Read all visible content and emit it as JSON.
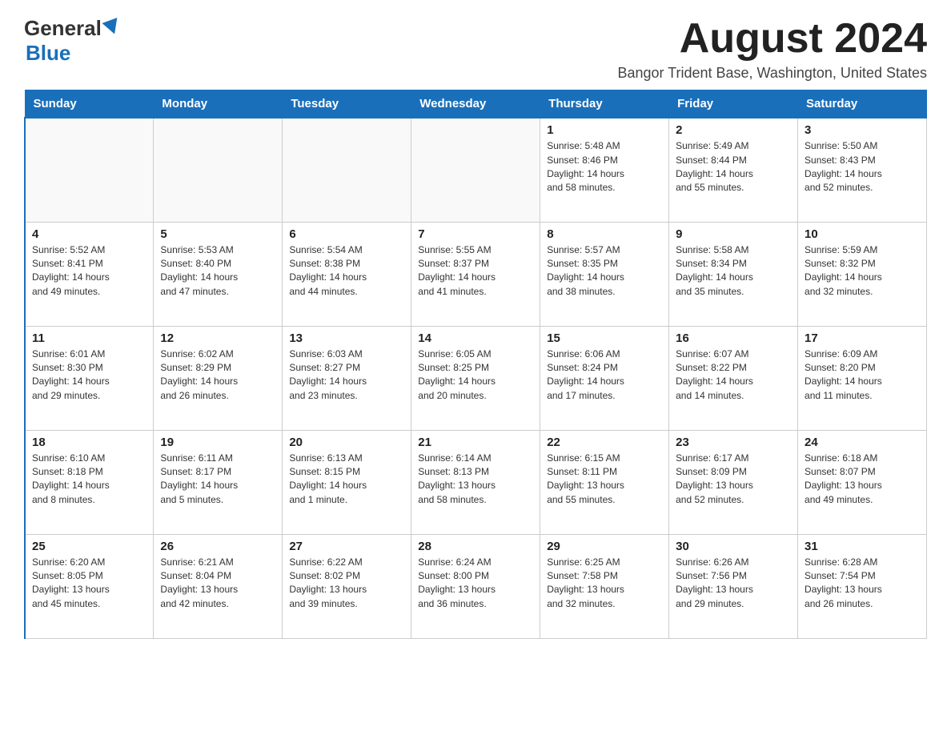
{
  "header": {
    "logo": {
      "general": "General",
      "blue": "Blue"
    },
    "title": "August 2024",
    "location": "Bangor Trident Base, Washington, United States"
  },
  "weekdays": [
    "Sunday",
    "Monday",
    "Tuesday",
    "Wednesday",
    "Thursday",
    "Friday",
    "Saturday"
  ],
  "weeks": [
    [
      {
        "day": "",
        "info": ""
      },
      {
        "day": "",
        "info": ""
      },
      {
        "day": "",
        "info": ""
      },
      {
        "day": "",
        "info": ""
      },
      {
        "day": "1",
        "info": "Sunrise: 5:48 AM\nSunset: 8:46 PM\nDaylight: 14 hours\nand 58 minutes."
      },
      {
        "day": "2",
        "info": "Sunrise: 5:49 AM\nSunset: 8:44 PM\nDaylight: 14 hours\nand 55 minutes."
      },
      {
        "day": "3",
        "info": "Sunrise: 5:50 AM\nSunset: 8:43 PM\nDaylight: 14 hours\nand 52 minutes."
      }
    ],
    [
      {
        "day": "4",
        "info": "Sunrise: 5:52 AM\nSunset: 8:41 PM\nDaylight: 14 hours\nand 49 minutes."
      },
      {
        "day": "5",
        "info": "Sunrise: 5:53 AM\nSunset: 8:40 PM\nDaylight: 14 hours\nand 47 minutes."
      },
      {
        "day": "6",
        "info": "Sunrise: 5:54 AM\nSunset: 8:38 PM\nDaylight: 14 hours\nand 44 minutes."
      },
      {
        "day": "7",
        "info": "Sunrise: 5:55 AM\nSunset: 8:37 PM\nDaylight: 14 hours\nand 41 minutes."
      },
      {
        "day": "8",
        "info": "Sunrise: 5:57 AM\nSunset: 8:35 PM\nDaylight: 14 hours\nand 38 minutes."
      },
      {
        "day": "9",
        "info": "Sunrise: 5:58 AM\nSunset: 8:34 PM\nDaylight: 14 hours\nand 35 minutes."
      },
      {
        "day": "10",
        "info": "Sunrise: 5:59 AM\nSunset: 8:32 PM\nDaylight: 14 hours\nand 32 minutes."
      }
    ],
    [
      {
        "day": "11",
        "info": "Sunrise: 6:01 AM\nSunset: 8:30 PM\nDaylight: 14 hours\nand 29 minutes."
      },
      {
        "day": "12",
        "info": "Sunrise: 6:02 AM\nSunset: 8:29 PM\nDaylight: 14 hours\nand 26 minutes."
      },
      {
        "day": "13",
        "info": "Sunrise: 6:03 AM\nSunset: 8:27 PM\nDaylight: 14 hours\nand 23 minutes."
      },
      {
        "day": "14",
        "info": "Sunrise: 6:05 AM\nSunset: 8:25 PM\nDaylight: 14 hours\nand 20 minutes."
      },
      {
        "day": "15",
        "info": "Sunrise: 6:06 AM\nSunset: 8:24 PM\nDaylight: 14 hours\nand 17 minutes."
      },
      {
        "day": "16",
        "info": "Sunrise: 6:07 AM\nSunset: 8:22 PM\nDaylight: 14 hours\nand 14 minutes."
      },
      {
        "day": "17",
        "info": "Sunrise: 6:09 AM\nSunset: 8:20 PM\nDaylight: 14 hours\nand 11 minutes."
      }
    ],
    [
      {
        "day": "18",
        "info": "Sunrise: 6:10 AM\nSunset: 8:18 PM\nDaylight: 14 hours\nand 8 minutes."
      },
      {
        "day": "19",
        "info": "Sunrise: 6:11 AM\nSunset: 8:17 PM\nDaylight: 14 hours\nand 5 minutes."
      },
      {
        "day": "20",
        "info": "Sunrise: 6:13 AM\nSunset: 8:15 PM\nDaylight: 14 hours\nand 1 minute."
      },
      {
        "day": "21",
        "info": "Sunrise: 6:14 AM\nSunset: 8:13 PM\nDaylight: 13 hours\nand 58 minutes."
      },
      {
        "day": "22",
        "info": "Sunrise: 6:15 AM\nSunset: 8:11 PM\nDaylight: 13 hours\nand 55 minutes."
      },
      {
        "day": "23",
        "info": "Sunrise: 6:17 AM\nSunset: 8:09 PM\nDaylight: 13 hours\nand 52 minutes."
      },
      {
        "day": "24",
        "info": "Sunrise: 6:18 AM\nSunset: 8:07 PM\nDaylight: 13 hours\nand 49 minutes."
      }
    ],
    [
      {
        "day": "25",
        "info": "Sunrise: 6:20 AM\nSunset: 8:05 PM\nDaylight: 13 hours\nand 45 minutes."
      },
      {
        "day": "26",
        "info": "Sunrise: 6:21 AM\nSunset: 8:04 PM\nDaylight: 13 hours\nand 42 minutes."
      },
      {
        "day": "27",
        "info": "Sunrise: 6:22 AM\nSunset: 8:02 PM\nDaylight: 13 hours\nand 39 minutes."
      },
      {
        "day": "28",
        "info": "Sunrise: 6:24 AM\nSunset: 8:00 PM\nDaylight: 13 hours\nand 36 minutes."
      },
      {
        "day": "29",
        "info": "Sunrise: 6:25 AM\nSunset: 7:58 PM\nDaylight: 13 hours\nand 32 minutes."
      },
      {
        "day": "30",
        "info": "Sunrise: 6:26 AM\nSunset: 7:56 PM\nDaylight: 13 hours\nand 29 minutes."
      },
      {
        "day": "31",
        "info": "Sunrise: 6:28 AM\nSunset: 7:54 PM\nDaylight: 13 hours\nand 26 minutes."
      }
    ]
  ]
}
